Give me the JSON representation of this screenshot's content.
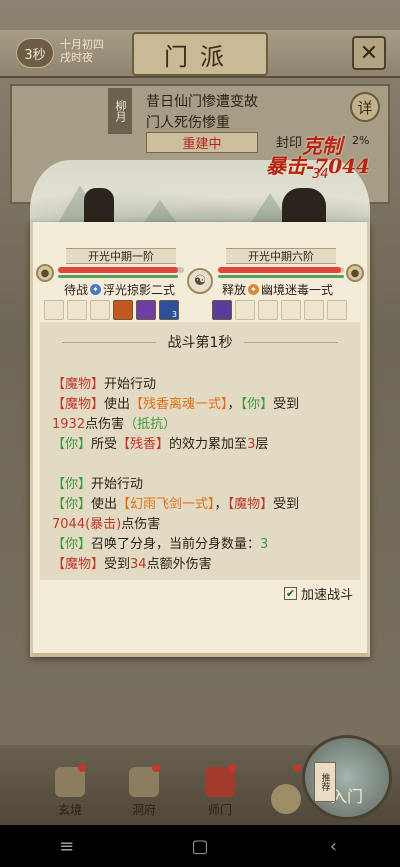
{
  "header": {
    "timer": "3秒",
    "date_line1": "十月初四",
    "date_line2": "戌时夜",
    "title": "门派",
    "close_icon": "close-icon"
  },
  "sect_news": {
    "side_tag": "柳月",
    "line1": "昔日仙门惨遭变故",
    "line2": "门人死伤惨重",
    "rebuild_label": "重建中",
    "seal_label": "封印",
    "seal_pct": "2%",
    "detail_label": "详"
  },
  "combat_float": {
    "counter": "克制",
    "crit": "暴击-7044",
    "sub": "34"
  },
  "battle": {
    "player": {
      "realm": "开光中期一阶",
      "stance_label": "待战",
      "stance_skill": "浮光掠影二式",
      "hp_frac": 0.95,
      "hp_color": "#e0463a",
      "mp_color": "#5aa05a"
    },
    "enemy": {
      "realm": "开光中期六阶",
      "stance_label": "释放",
      "stance_skill": "幽境迷毒一式",
      "hp_frac": 0.98,
      "hp_color": "#e0463a",
      "mp_color": "#5aa05a"
    },
    "player_slot_3_count": "3"
  },
  "log": {
    "header": "战斗第1秒",
    "l1_a": "【魔物】",
    "l1_b": "开始行动",
    "l2_a": "【魔物】",
    "l2_b": "使出",
    "l2_c": "【残香离魂一式】",
    "l2_d": "，",
    "l2_e": "【你】",
    "l2_f": "受到",
    "l3_a": "1932",
    "l3_b": "点伤害",
    "l3_c": "（抵抗）",
    "l4_a": "【你】",
    "l4_b": "所受",
    "l4_c": "【残香】",
    "l4_d": "的效力累加至",
    "l4_e": "3",
    "l4_f": "层",
    "l5_a": "【你】",
    "l5_b": "开始行动",
    "l6_a": "【你】",
    "l6_b": "使出",
    "l6_c": "【幻雨飞剑一式】",
    "l6_d": "，",
    "l6_e": "【魔物】",
    "l6_f": "受到",
    "l7_a": "7044",
    "l7_b": "(暴击)",
    "l7_c": "点伤害",
    "l8_a": "【你】",
    "l8_b": "召唤了分身，当前分身数量：",
    "l8_c": "3",
    "l9_a": "【魔物】",
    "l9_b": "受到",
    "l9_c": "34",
    "l9_d": "点额外伤害"
  },
  "accelerate": {
    "label": "加速战斗",
    "checked": true
  },
  "bottom_nav": {
    "item1": "玄境",
    "item2": "洞府",
    "item3": "师门",
    "enter_tag": "推荐",
    "enter": "入门"
  },
  "system_nav": {
    "menu": "≡",
    "home": "▢",
    "back": "‹"
  }
}
